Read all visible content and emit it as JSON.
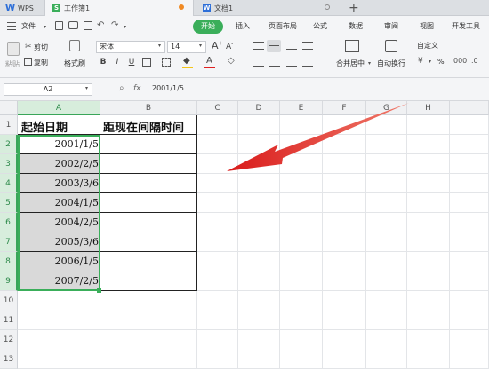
{
  "tabs": [
    {
      "label": "WPS",
      "color": "#2e6fd8",
      "icon": "wps-logo-icon"
    },
    {
      "label": "工作簿1",
      "color": "#3aae5a",
      "icon": "spreadsheet-icon"
    },
    {
      "label": "文档1",
      "color": "#2e6fd8",
      "icon": "writer-doc-icon"
    }
  ],
  "menu": {
    "file": "文件",
    "items": [
      "开始",
      "插入",
      "页面布局",
      "公式",
      "数据",
      "审阅",
      "视图",
      "开发工具"
    ]
  },
  "toolbar": {
    "paste": "粘贴",
    "cut": "剪切",
    "copy": "复制",
    "format_painter": "格式刷",
    "font_name": "宋体",
    "font_size": "14",
    "merge_center": "合并居中",
    "wrap_text": "自动换行",
    "number_format": "自定义",
    "percent": "%"
  },
  "formula": {
    "name_box": "A2",
    "fx": "fx",
    "content": "2001/1/5"
  },
  "sheet": {
    "columns": [
      "A",
      "B",
      "C",
      "D",
      "E",
      "F",
      "G",
      "H",
      "I"
    ],
    "rows": [
      "1",
      "2",
      "3",
      "4",
      "5",
      "6",
      "7",
      "8",
      "9",
      "10",
      "11",
      "12",
      "13"
    ],
    "header_a": "起始日期",
    "header_b": "距现在间隔时间",
    "dates": [
      "2001/1/5",
      "2002/2/5",
      "2003/3/6",
      "2004/1/5",
      "2004/2/5",
      "2005/3/6",
      "2006/1/5",
      "2007/2/5"
    ]
  },
  "colors": {
    "accent": "#3aae5a",
    "selection_fill": "#d9d9d9",
    "arrow": "#e02020"
  }
}
